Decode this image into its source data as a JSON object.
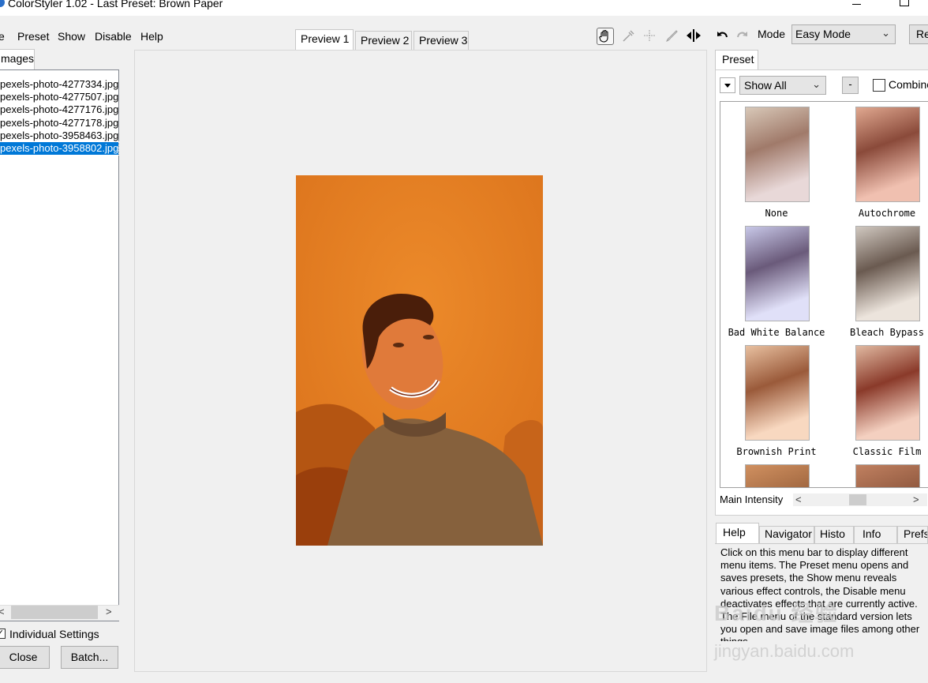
{
  "window": {
    "title": "ColorStyler 1.02 - Last Preset: Brown Paper"
  },
  "menu": {
    "file": "e",
    "preset": "Preset",
    "show": "Show",
    "disable": "Disable",
    "help": "Help"
  },
  "preview_tabs": [
    "Preview 1",
    "Preview 2",
    "Preview 3"
  ],
  "images": {
    "tab_label": "mages",
    "files": [
      "pexels-photo-4277334.jpg",
      "pexels-photo-4277507.jpg",
      "pexels-photo-4277176.jpg",
      "pexels-photo-4277178.jpg",
      "pexels-photo-3958463.jpg",
      "pexels-photo-3958802.jpg"
    ],
    "selected_index": 5,
    "individual_settings_label": "Individual Settings",
    "individual_settings_checked": true
  },
  "buttons": {
    "close": "Close",
    "batch": "Batch..."
  },
  "toolbar": {
    "mode_label": "Mode",
    "mode_value": "Easy Mode",
    "reset_label": "Re",
    "icons": [
      "hand-pan-icon",
      "eyedropper-icon",
      "crosshair-icon",
      "brush-icon",
      "split-compare-icon",
      "undo-icon",
      "redo-icon"
    ]
  },
  "preset_panel": {
    "tab_label": "Preset",
    "filter_value": "Show All",
    "dot_button": "-",
    "combine_label": "Combine",
    "presets": [
      "None",
      "Autochrome",
      "Bad White Balance",
      "Bleach Bypass",
      "Brownish Print",
      "Classic Film"
    ],
    "main_intensity_label": "Main Intensity"
  },
  "info_tabs": [
    "Help",
    "Navigator",
    "Histo",
    "Info",
    "Prefs"
  ],
  "help_text": "Click on this menu bar to display different menu items. The Preset menu opens and saves presets, the Show menu reveals various effect controls, the Disable menu deactivates effects that are currently active. The File menu of the standard version lets you open and save image files among other things.",
  "watermark": {
    "main": "Baidu 经验",
    "sub": "jingyan.baidu.com"
  },
  "colors": {
    "selection": "#0078d7",
    "photo_tone": "#e07a1c"
  }
}
